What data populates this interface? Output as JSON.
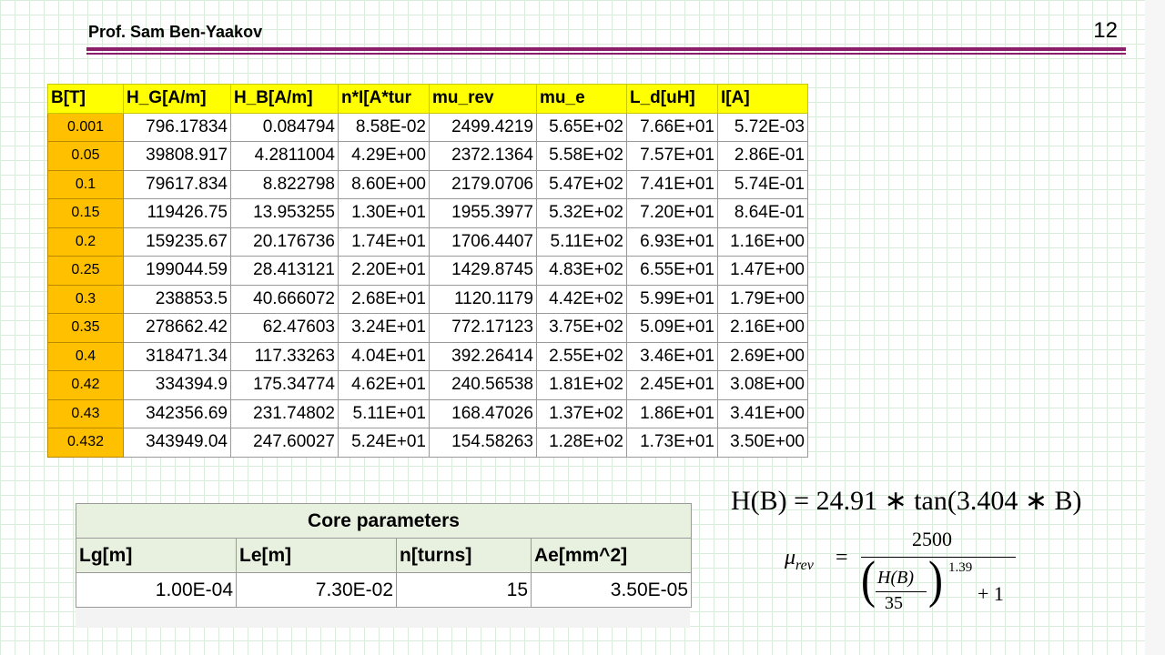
{
  "header": {
    "author": "Prof. Sam Ben-Yaakov",
    "page_number": "12"
  },
  "data_table": {
    "columns": [
      "B[T]",
      "H_G[A/m]",
      "H_B[A/m]",
      "n*I[A*tur",
      "mu_rev",
      "mu_e",
      "L_d[uH]",
      "I[A]"
    ],
    "rows": [
      [
        "0.001",
        "796.17834",
        "0.084794",
        "8.58E-02",
        "2499.4219",
        "5.65E+02",
        "7.66E+01",
        "5.72E-03"
      ],
      [
        "0.05",
        "39808.917",
        "4.2811004",
        "4.29E+00",
        "2372.1364",
        "5.58E+02",
        "7.57E+01",
        "2.86E-01"
      ],
      [
        "0.1",
        "79617.834",
        "8.822798",
        "8.60E+00",
        "2179.0706",
        "5.47E+02",
        "7.41E+01",
        "5.74E-01"
      ],
      [
        "0.15",
        "119426.75",
        "13.953255",
        "1.30E+01",
        "1955.3977",
        "5.32E+02",
        "7.20E+01",
        "8.64E-01"
      ],
      [
        "0.2",
        "159235.67",
        "20.176736",
        "1.74E+01",
        "1706.4407",
        "5.11E+02",
        "6.93E+01",
        "1.16E+00"
      ],
      [
        "0.25",
        "199044.59",
        "28.413121",
        "2.20E+01",
        "1429.8745",
        "4.83E+02",
        "6.55E+01",
        "1.47E+00"
      ],
      [
        "0.3",
        "238853.5",
        "40.666072",
        "2.68E+01",
        "1120.1179",
        "4.42E+02",
        "5.99E+01",
        "1.79E+00"
      ],
      [
        "0.35",
        "278662.42",
        "62.47603",
        "3.24E+01",
        "772.17123",
        "3.75E+02",
        "5.09E+01",
        "2.16E+00"
      ],
      [
        "0.4",
        "318471.34",
        "117.33263",
        "4.04E+01",
        "392.26414",
        "2.55E+02",
        "3.46E+01",
        "2.69E+00"
      ],
      [
        "0.42",
        "334394.9",
        "175.34774",
        "4.62E+01",
        "240.56538",
        "1.81E+02",
        "2.45E+01",
        "3.08E+00"
      ],
      [
        "0.43",
        "342356.69",
        "231.74802",
        "5.11E+01",
        "168.47026",
        "1.37E+02",
        "1.86E+01",
        "3.41E+00"
      ],
      [
        "0.432",
        "343949.04",
        "247.60027",
        "5.24E+01",
        "154.58263",
        "1.28E+02",
        "1.73E+01",
        "3.50E+00"
      ]
    ]
  },
  "core_parameters": {
    "title": "Core parameters",
    "headers": [
      "Lg[m]",
      "Le[m]",
      "n[turns]",
      "Ae[mm^2]"
    ],
    "values": [
      "1.00E-04",
      "7.30E-02",
      "15",
      "3.50E-05"
    ]
  },
  "formulas": {
    "h_of_b": "H(B) = 24.91 ∗ tan(3.404 ∗ B)",
    "mu_rev": {
      "lhs": "μ",
      "lhs_sub": "rev",
      "equals": "=",
      "numerator": "2500",
      "inner_numerator": "H(B)",
      "inner_denominator": "35",
      "exponent": "1.39",
      "plus_term": "+ 1"
    }
  },
  "colors": {
    "header_row": "#ffff00",
    "b_column": "#ffc000",
    "core_table": "#e8f0df",
    "rule": "#8b1f6a"
  }
}
